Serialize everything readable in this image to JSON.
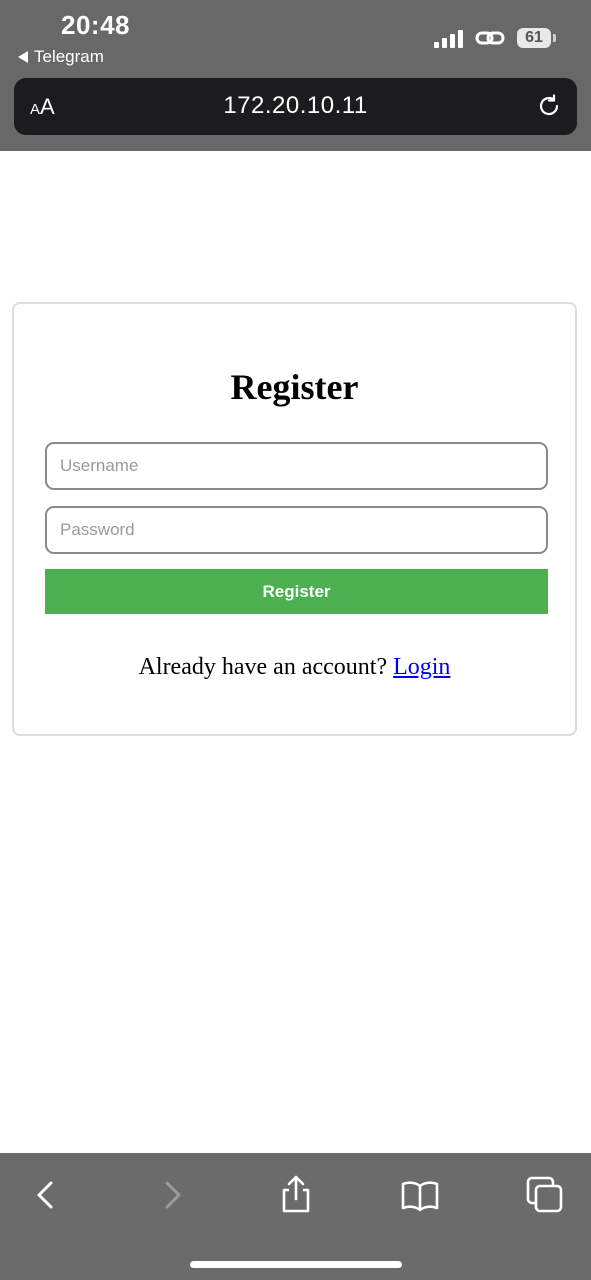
{
  "status_bar": {
    "time": "20:48",
    "back_app": "Telegram",
    "battery": "61",
    "icons": [
      "signal-icon",
      "link-icon",
      "battery-icon"
    ]
  },
  "browser": {
    "text_size_label_small": "A",
    "text_size_label_large": "A",
    "url": "172.20.10.11",
    "reload_icon": "reload-icon"
  },
  "form": {
    "title": "Register",
    "username_placeholder": "Username",
    "password_placeholder": "Password",
    "submit_label": "Register",
    "footer_text": "Already have an account? ",
    "login_link": "Login",
    "accent_color": "#4caf50",
    "link_color": "#0000ee"
  },
  "toolbar": {
    "icons": [
      "back-icon",
      "forward-icon",
      "share-icon",
      "bookmarks-icon",
      "tabs-icon"
    ]
  }
}
